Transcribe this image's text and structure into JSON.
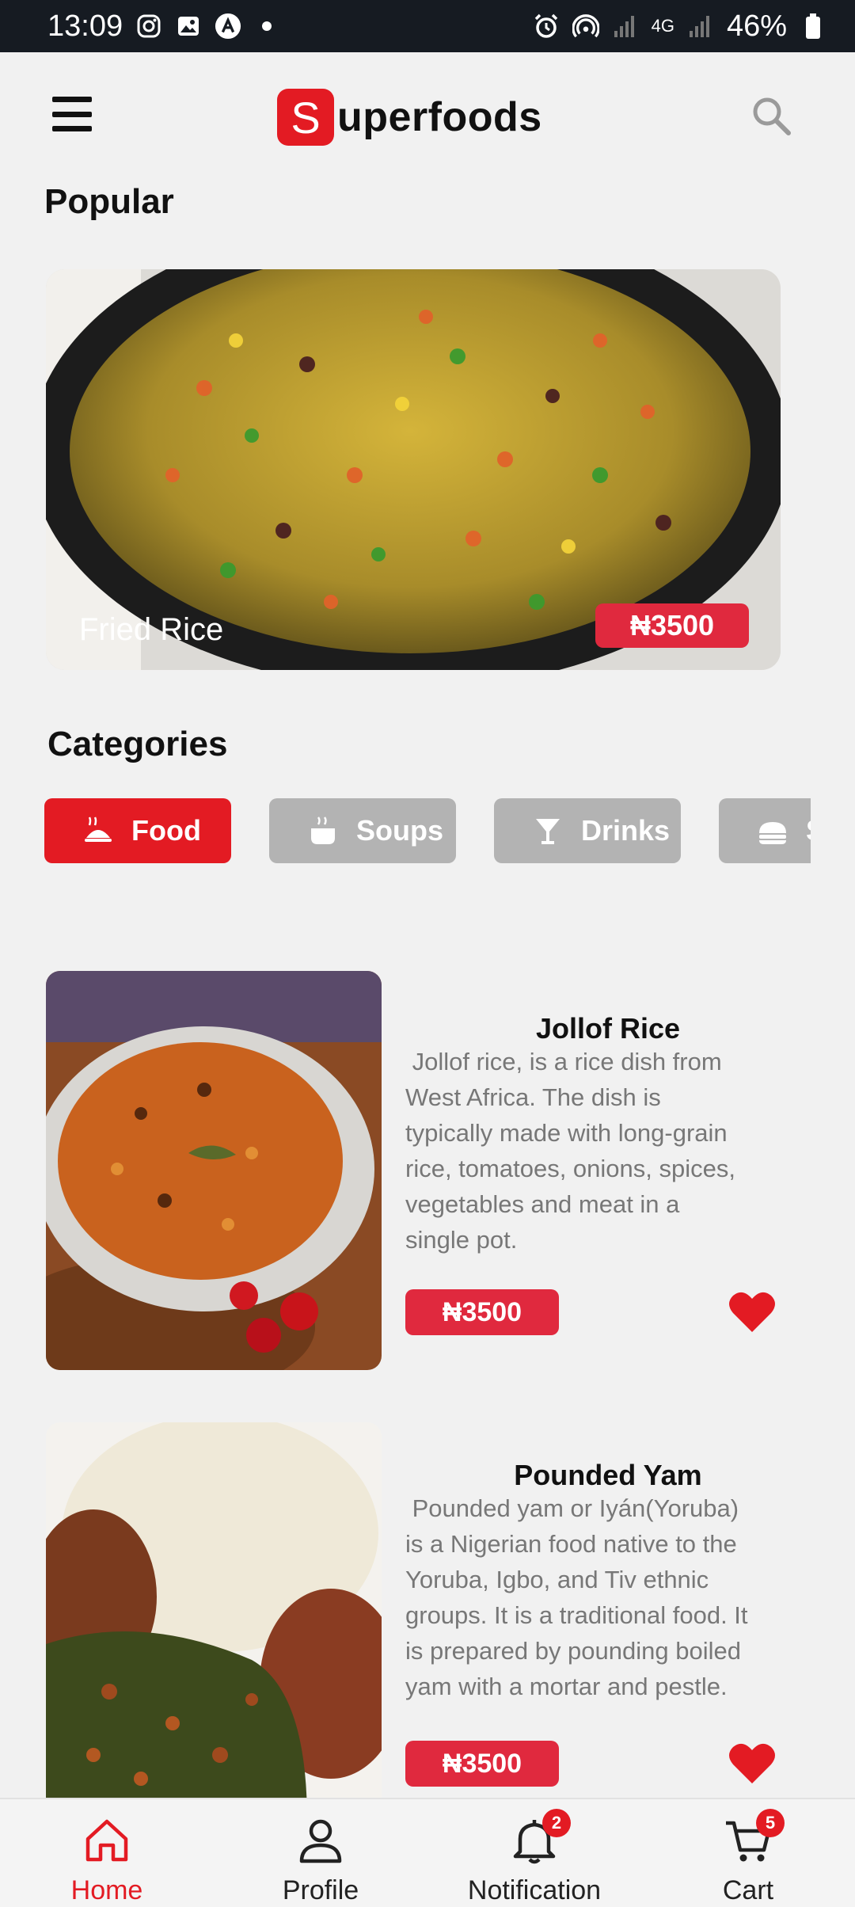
{
  "status_bar": {
    "time": "13:09",
    "network": "4G",
    "battery": "46%"
  },
  "header": {
    "logo_letter": "S",
    "logo_rest": "uperfoods"
  },
  "popular": {
    "title": "Popular",
    "item": {
      "name": "Fried Rice",
      "price": "₦3500"
    }
  },
  "categories": {
    "title": "Categories",
    "items": [
      {
        "label": "Food",
        "icon": "food-icon",
        "active": true
      },
      {
        "label": "Soups",
        "icon": "soup-icon",
        "active": false
      },
      {
        "label": "Drinks",
        "icon": "drink-icon",
        "active": false
      },
      {
        "label": "S",
        "icon": "snacks-icon",
        "active": false
      }
    ]
  },
  "foods": [
    {
      "title": "Jollof Rice",
      "desc_lines": [
        " Jollof rice, is a rice dish from",
        "West Africa. The dish is",
        "typically made with long-grain",
        "rice, tomatoes, onions, spices,",
        "vegetables and meat in a",
        "single pot."
      ],
      "price": "₦3500",
      "favorite": true
    },
    {
      "title": "Pounded Yam",
      "desc_lines": [
        " Pounded yam or Iyán(Yoruba)",
        "is a Nigerian food native to the",
        "Yoruba, Igbo, and Tiv ethnic",
        "groups. It is a traditional food. It",
        "is prepared by pounding boiled",
        "yam with a mortar and pestle."
      ],
      "price": "₦3500",
      "favorite": true
    }
  ],
  "bottom_nav": {
    "items": [
      {
        "label": "Home",
        "icon": "home-icon",
        "active": true
      },
      {
        "label": "Profile",
        "icon": "profile-icon",
        "active": false
      },
      {
        "label": "Notification",
        "icon": "bell-icon",
        "badge": "2",
        "active": false
      },
      {
        "label": "Cart",
        "icon": "cart-icon",
        "badge": "5",
        "active": false
      }
    ]
  },
  "colors": {
    "accent": "#e31b23",
    "price_bg": "#e0293e",
    "chip_inactive": "#b3b3b3",
    "status_bar": "#161b22"
  }
}
